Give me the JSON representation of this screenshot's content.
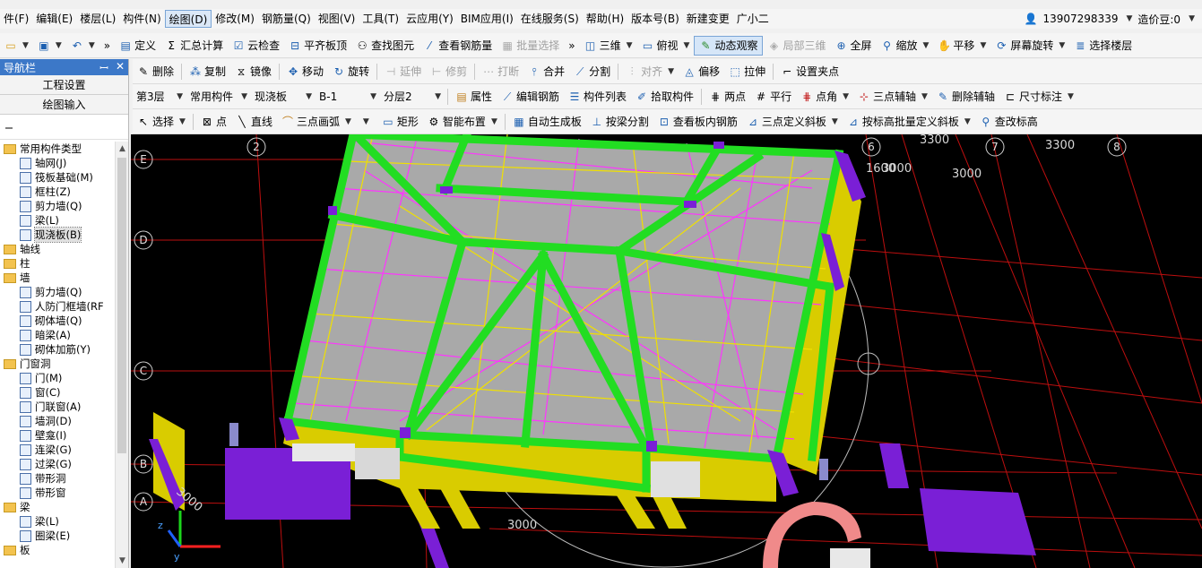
{
  "menu": [
    "件(F)",
    "编辑(E)",
    "楼层(L)",
    "构件(N)",
    "绘图(D)",
    "修改(M)",
    "钢筋量(Q)",
    "视图(V)",
    "工具(T)",
    "云应用(Y)",
    "BIM应用(I)",
    "在线服务(S)",
    "帮助(H)",
    "版本号(B)",
    "新建变更",
    "广小二"
  ],
  "menu_active_index": 4,
  "account": {
    "phone": "13907298339",
    "beans": "造价豆:0"
  },
  "toolbar1": {
    "define": "定义",
    "summary": "汇总计算",
    "cloud_check": "云检查",
    "flush_top": "平齐板顶",
    "find": "查找图元",
    "view_rebar": "查看钢筋量",
    "batch_select": "批量选择",
    "view3d": "三维",
    "top_view": "俯视",
    "dynamic": "动态观察",
    "local3d": "局部三维",
    "fullscreen": "全屏",
    "zoom": "缩放",
    "pan": "平移",
    "rotate_screen": "屏幕旋转",
    "select_floor": "选择楼层"
  },
  "toolbar2": {
    "delete": "删除",
    "copy": "复制",
    "mirror": "镜像",
    "move": "移动",
    "rotate": "旋转",
    "extend": "延伸",
    "trim": "修剪",
    "break": "打断",
    "merge": "合并",
    "split": "分割",
    "align": "对齐",
    "offset": "偏移",
    "stretch": "拉伸",
    "grip": "设置夹点"
  },
  "toolbar3": {
    "floor": "第3层",
    "category": "常用构件",
    "type": "现浇板",
    "name": "B-1",
    "layer": "分层2",
    "props": "属性",
    "edit_rebar": "编辑钢筋",
    "list": "构件列表",
    "pick": "拾取构件",
    "two_points": "两点",
    "parallel": "平行",
    "point_angle": "点角",
    "three_pt_aux": "三点辅轴",
    "del_aux": "删除辅轴",
    "dimension": "尺寸标注"
  },
  "toolbar4": {
    "select": "选择",
    "point": "点",
    "line": "直线",
    "arc": "三点画弧",
    "rect": "矩形",
    "smart": "智能布置",
    "auto_gen": "自动生成板",
    "beam_split": "按梁分割",
    "view_inner": "查看板内钢筋",
    "three_pt_slope": "三点定义斜板",
    "batch_slope": "按标高批量定义斜板",
    "check_elev": "查改标高"
  },
  "nav": {
    "title": "导航栏",
    "tabs": [
      "工程设置",
      "绘图输入"
    ],
    "tree": [
      {
        "level": 1,
        "type": "folder",
        "label": "常用构件类型"
      },
      {
        "level": 2,
        "type": "item",
        "label": "轴网(J)"
      },
      {
        "level": 2,
        "type": "item",
        "label": "筏板基础(M)"
      },
      {
        "level": 2,
        "type": "item",
        "label": "框柱(Z)"
      },
      {
        "level": 2,
        "type": "item",
        "label": "剪力墙(Q)"
      },
      {
        "level": 2,
        "type": "item",
        "label": "梁(L)"
      },
      {
        "level": 2,
        "type": "item",
        "label": "现浇板(B)",
        "selected": true
      },
      {
        "level": 1,
        "type": "folder",
        "label": "轴线"
      },
      {
        "level": 1,
        "type": "folder",
        "label": "柱"
      },
      {
        "level": 1,
        "type": "folder",
        "label": "墙"
      },
      {
        "level": 2,
        "type": "item",
        "label": "剪力墙(Q)"
      },
      {
        "level": 2,
        "type": "item",
        "label": "人防门框墙(RF"
      },
      {
        "level": 2,
        "type": "item",
        "label": "砌体墙(Q)"
      },
      {
        "level": 2,
        "type": "item",
        "label": "暗梁(A)"
      },
      {
        "level": 2,
        "type": "item",
        "label": "砌体加筋(Y)"
      },
      {
        "level": 1,
        "type": "folder",
        "label": "门窗洞"
      },
      {
        "level": 2,
        "type": "item",
        "label": "门(M)"
      },
      {
        "level": 2,
        "type": "item",
        "label": "窗(C)"
      },
      {
        "level": 2,
        "type": "item",
        "label": "门联窗(A)"
      },
      {
        "level": 2,
        "type": "item",
        "label": "墙洞(D)"
      },
      {
        "level": 2,
        "type": "item",
        "label": "壁龛(I)"
      },
      {
        "level": 2,
        "type": "item",
        "label": "连梁(G)"
      },
      {
        "level": 2,
        "type": "item",
        "label": "过梁(G)"
      },
      {
        "level": 2,
        "type": "item",
        "label": "带形洞"
      },
      {
        "level": 2,
        "type": "item",
        "label": "带形窗"
      },
      {
        "level": 1,
        "type": "folder",
        "label": "梁"
      },
      {
        "level": 2,
        "type": "item",
        "label": "梁(L)"
      },
      {
        "level": 2,
        "type": "item",
        "label": "圈梁(E)"
      },
      {
        "level": 1,
        "type": "folder",
        "label": "板"
      }
    ]
  },
  "viewport": {
    "axis_rows": [
      "E",
      "D",
      "C",
      "B",
      "A"
    ],
    "axis_cols": [
      "2",
      "6",
      "7",
      "8"
    ],
    "dims": [
      "3300",
      "3300",
      "1600",
      "3000",
      "3000",
      "3000",
      "3000"
    ],
    "colors": {
      "beam": "#22dd22",
      "slab": "#a8a8a8",
      "rebar_yellow": "#f0e000",
      "rebar_magenta": "#ff33ff",
      "column": "#7a1fd6",
      "wall": "#d8cc00",
      "grid": "#d21010"
    }
  }
}
